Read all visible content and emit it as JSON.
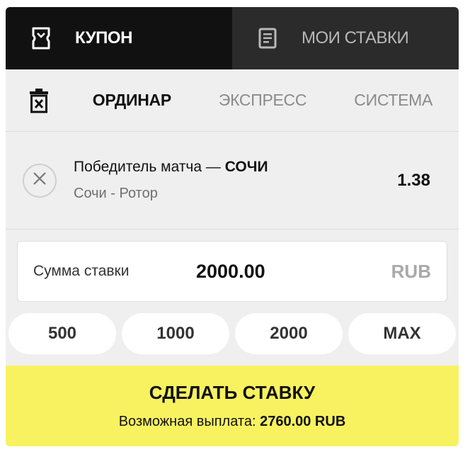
{
  "tabs": {
    "coupon": {
      "label": "КУПОН",
      "icon": "coupon-icon"
    },
    "my_bets": {
      "label": "МОИ СТАВКИ",
      "icon": "document-icon"
    }
  },
  "bet_types": {
    "clear_icon": "trash-icon",
    "single": "ОРДИНАР",
    "express": "ЭКСПРЕСС",
    "system": "СИСТЕМА"
  },
  "selection": {
    "market": "Победитель матча — ",
    "outcome": "СОЧИ",
    "event": "Сочи - Ротор",
    "odds": "1.38",
    "remove_icon": "close-icon"
  },
  "stake": {
    "label": "Сумма ставки",
    "value": "2000.00",
    "currency": "RUB"
  },
  "quick_amounts": [
    "500",
    "1000",
    "2000",
    "MAX"
  ],
  "place_bet": {
    "label": "СДЕЛАТЬ СТАВКУ",
    "payout_label": "Возможная выплата: ",
    "payout_value": "2760.00 RUB"
  },
  "colors": {
    "active_tab": "#111111",
    "inactive_tab": "#2b2b2b",
    "place_button": "#f8f260",
    "background": "#efefef"
  }
}
